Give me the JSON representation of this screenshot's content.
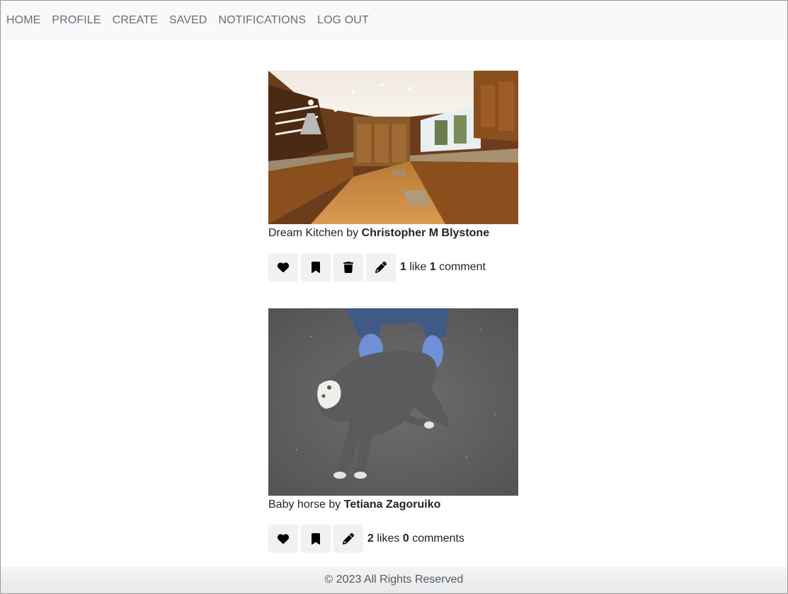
{
  "nav": {
    "items": [
      "HOME",
      "PROFILE",
      "CREATE",
      "SAVED",
      "NOTIFICATIONS",
      "LOG OUT"
    ]
  },
  "posts": [
    {
      "title": "Dream Kitchen",
      "by": "by",
      "author": "Christopher M Blystone",
      "likes_count": "1",
      "likes_word": "like",
      "comments_count": "1",
      "comments_word": "comment",
      "image": "kitchen-photo"
    },
    {
      "title": "Baby horse",
      "by": "by",
      "author": "Tetiana Zagoruiko",
      "likes_count": "2",
      "likes_word": "likes",
      "comments_count": "0",
      "comments_word": "comments",
      "image": "baby-horse-photo"
    }
  ],
  "footer": {
    "text": "© 2023 All Rights Reserved"
  },
  "icons": {
    "like": "heart-icon",
    "save": "bookmark-icon",
    "delete": "trash-icon",
    "edit": "pencil-icon"
  }
}
